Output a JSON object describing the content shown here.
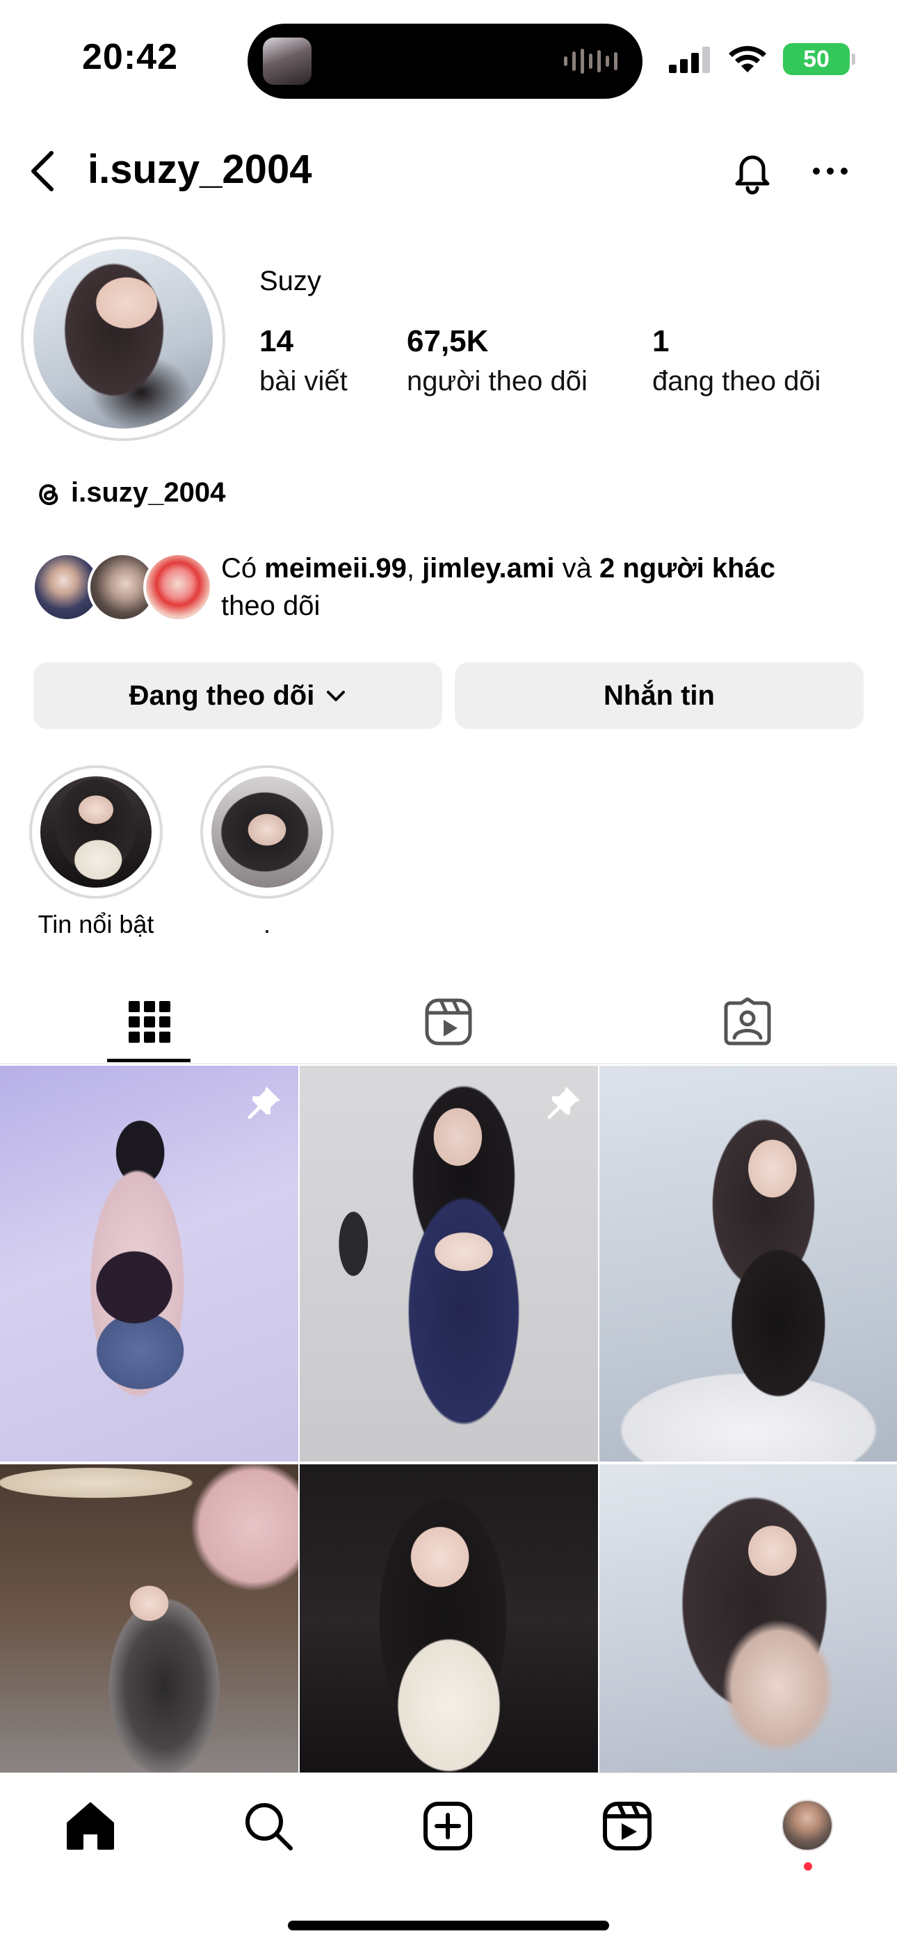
{
  "status_bar": {
    "time": "20:42",
    "battery": "50"
  },
  "header": {
    "username": "i.suzy_2004"
  },
  "profile": {
    "display_name": "Suzy",
    "stats": [
      {
        "value": "14",
        "label": "bài viết"
      },
      {
        "value": "67,5K",
        "label": "người theo dõi"
      },
      {
        "value": "1",
        "label": "đang theo dõi"
      }
    ],
    "threads_handle": "i.suzy_2004",
    "followed_by": {
      "prefix": "Có ",
      "user1": "meimeii.99",
      "sep": ", ",
      "user2": "jimley.ami",
      "mid": " và ",
      "others": "2 người khác",
      "suffix": "theo dõi"
    }
  },
  "actions": {
    "following_label": "Đang theo dõi",
    "message_label": "Nhắn tin"
  },
  "highlights": [
    {
      "label": "Tin nổi bật"
    },
    {
      "label": "."
    }
  ],
  "tabs": [
    "grid-icon",
    "reels-icon",
    "tagged-icon"
  ],
  "colors": {
    "battery": "#34c759",
    "notification_dot": "#ff3040",
    "button_bg": "#efefef"
  }
}
